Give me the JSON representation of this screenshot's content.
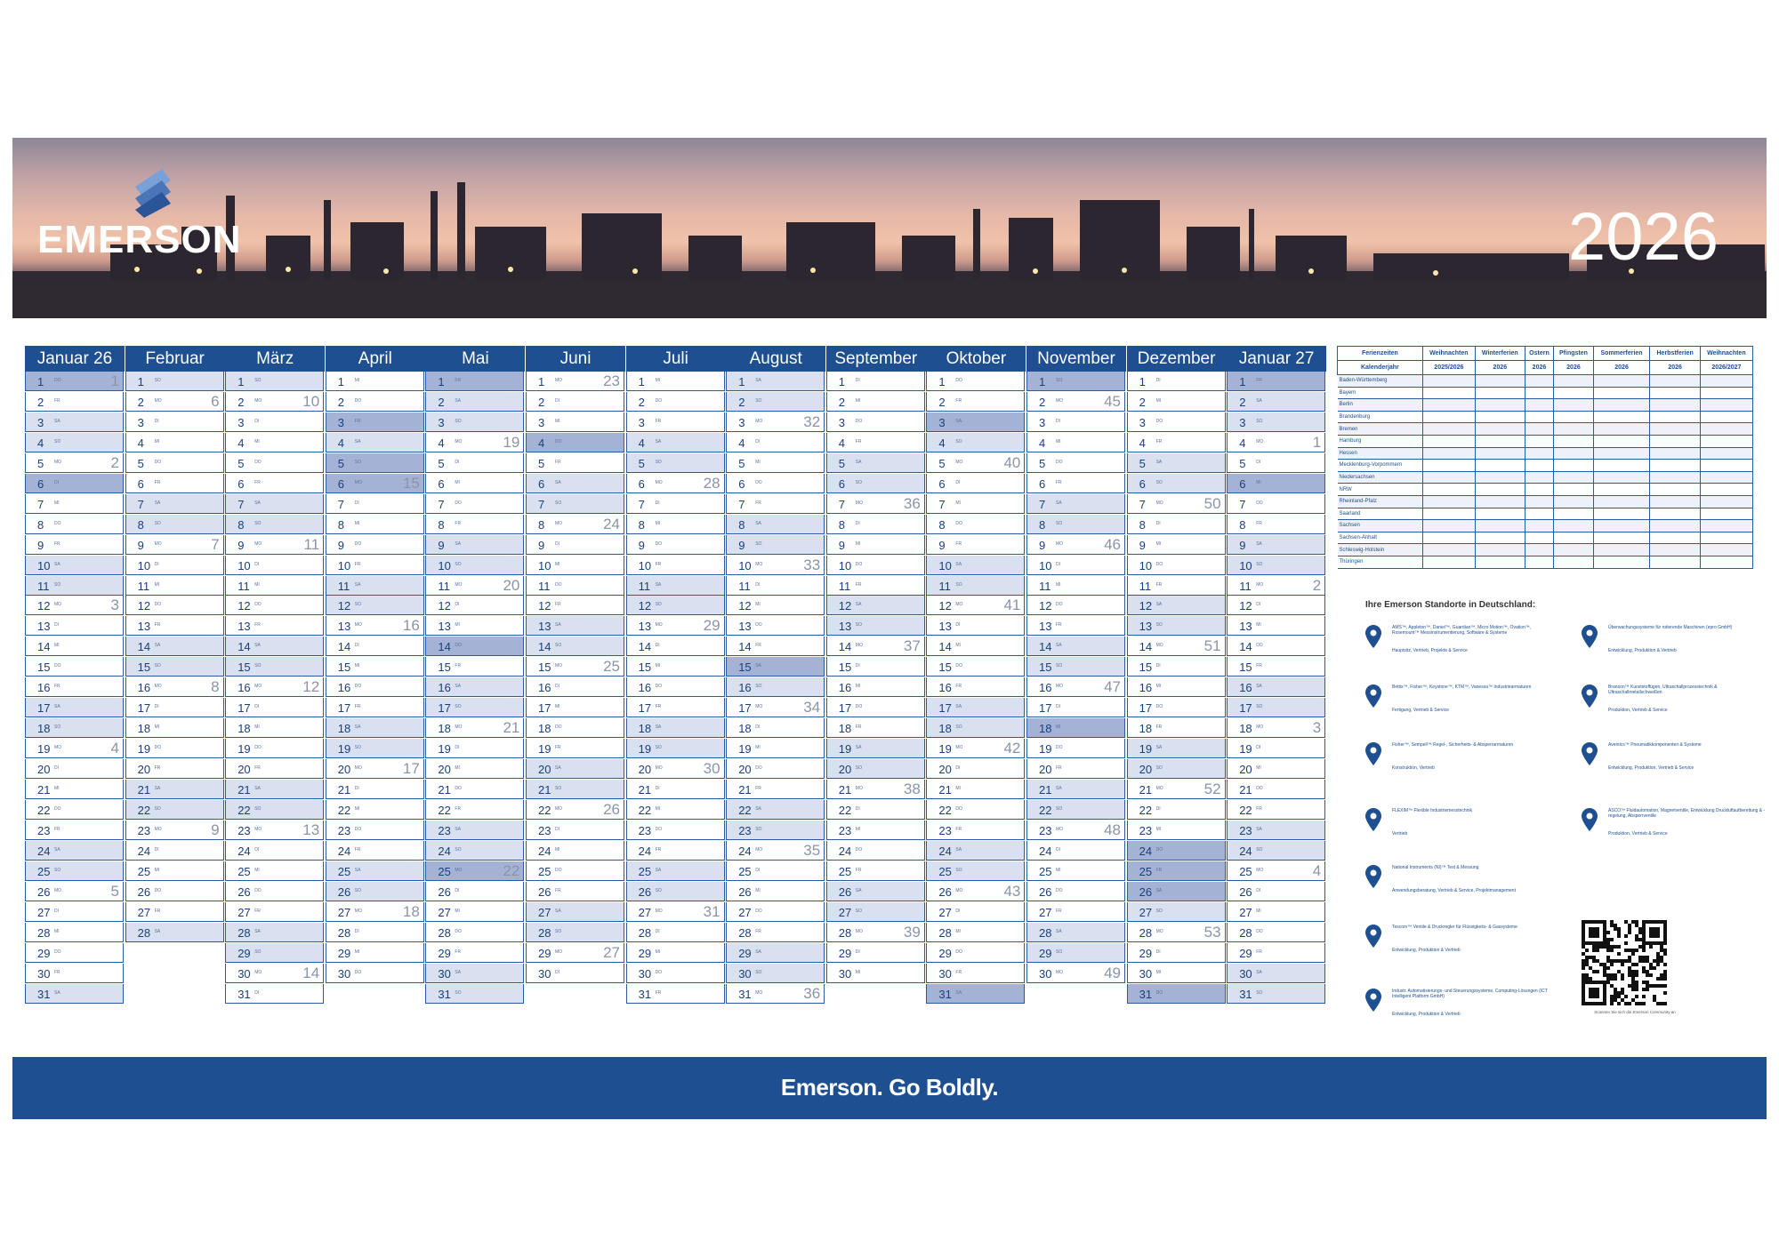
{
  "header": {
    "brand": "EMERSON",
    "year": "2026"
  },
  "calendar": {
    "months": [
      {
        "name": "Januar 26",
        "days": 31,
        "start": 3,
        "kw": {
          "1": "1",
          "5": "2",
          "12": "3",
          "19": "4",
          "26": "5"
        },
        "hol": [
          1,
          6
        ]
      },
      {
        "name": "Februar",
        "days": 28,
        "start": 6,
        "kw": {
          "2": "6",
          "9": "7",
          "16": "8",
          "23": "9"
        },
        "hol": []
      },
      {
        "name": "März",
        "days": 31,
        "start": 6,
        "kw": {
          "2": "10",
          "9": "11",
          "16": "12",
          "23": "13",
          "30": "14"
        },
        "hol": []
      },
      {
        "name": "April",
        "days": 30,
        "start": 2,
        "kw": {
          "6": "15",
          "13": "16",
          "20": "17",
          "27": "18"
        },
        "hol": [
          3,
          5,
          6
        ]
      },
      {
        "name": "Mai",
        "days": 31,
        "start": 4,
        "kw": {
          "4": "19",
          "11": "20",
          "18": "21",
          "25": "22"
        },
        "hol": [
          1,
          14,
          25
        ]
      },
      {
        "name": "Juni",
        "days": 30,
        "start": 0,
        "kw": {
          "1": "23",
          "8": "24",
          "15": "25",
          "22": "26",
          "29": "27"
        },
        "hol": [
          4
        ]
      },
      {
        "name": "Juli",
        "days": 31,
        "start": 2,
        "kw": {
          "6": "28",
          "13": "29",
          "20": "30",
          "27": "31"
        },
        "hol": []
      },
      {
        "name": "August",
        "days": 31,
        "start": 5,
        "kw": {
          "3": "32",
          "10": "33",
          "17": "34",
          "24": "35",
          "31": "36"
        },
        "hol": [
          15
        ]
      },
      {
        "name": "September",
        "days": 30,
        "start": 1,
        "kw": {
          "7": "36",
          "14": "37",
          "21": "38",
          "28": "39"
        },
        "hol": []
      },
      {
        "name": "Oktober",
        "days": 31,
        "start": 3,
        "kw": {
          "5": "40",
          "12": "41",
          "19": "42",
          "26": "43"
        },
        "hol": [
          3,
          31
        ]
      },
      {
        "name": "November",
        "days": 30,
        "start": 6,
        "kw": {
          "2": "45",
          "9": "46",
          "16": "47",
          "23": "48",
          "30": "49"
        },
        "hol": [
          1,
          18
        ]
      },
      {
        "name": "Dezember",
        "days": 31,
        "start": 1,
        "kw": {
          "7": "50",
          "14": "51",
          "21": "52",
          "28": "53"
        },
        "hol": [
          24,
          25,
          26,
          31
        ]
      },
      {
        "name": "Januar 27",
        "days": 31,
        "start": 4,
        "kw": {
          "4": "1",
          "11": "2",
          "18": "3",
          "25": "4"
        },
        "hol": [
          1,
          6
        ]
      }
    ]
  },
  "holidays_table": {
    "headers": [
      "Ferienzeiten",
      "Weihnachten",
      "Winterferien",
      "Ostern",
      "Pfingsten",
      "Sommerferien",
      "Herbstferien",
      "Weihnachten"
    ],
    "subheaders": [
      "Kalenderjahr",
      "2025/2026",
      "2026",
      "2026",
      "2026",
      "2026",
      "2026",
      "2026/2027"
    ],
    "rows": [
      "Baden-Württemberg",
      "Bayern",
      "Berlin",
      "Brandenburg",
      "Bremen",
      "Hamburg",
      "Hessen",
      "Mecklenburg-Vorpommern",
      "Niedersachsen",
      "NRW",
      "Rheinland-Pfalz",
      "Saarland",
      "Sachsen",
      "Sachsen-Anhalt",
      "Schleswig-Holstein",
      "Thüringen"
    ]
  },
  "locations": {
    "title": "Ihre Emerson Standorte in Deutschland:",
    "items": [
      {
        "l1": "AMS™, Appleton™, Daniel™, Guardian™, Micro Motion™, Ovation™, Rosemount™ Messinstrumentierung, Software & Systeme",
        "l2": "Hauptsitz, Vertrieb, Projekte & Service"
      },
      {
        "l1": "Überwachungssysteme für rotierende Maschinen (epro GmbH)",
        "l2": "Entwicklung, Produktion & Vertrieb"
      },
      {
        "l1": "Bettis™, Fisher™, Keystone™, KTM™, Vanessa™ Industriearmaturen",
        "l2": "Fertigung, Vertrieb & Service"
      },
      {
        "l1": "Branson™ Kunststoffügen, Ultraschallprozesstechnik & Ultraschallmetallschweißen",
        "l2": "Produktion, Vertrieb & Service"
      },
      {
        "l1": "Fisher™, Sempell™ Regel-, Sicherheits- & Absperrarmaturen",
        "l2": "Konstruktion, Vertrieb"
      },
      {
        "l1": "Aventics™ Pneumatikkomponenten & Systeme",
        "l2": "Entwicklung, Produktion, Vertrieb & Service"
      },
      {
        "l1": "FLEXIM™ Flexible Industriemesstechnik",
        "l2": "Vertrieb"
      },
      {
        "l1": "ASCO™ Fluidautomation, Magnetventile, Entwicklung Druckluftaufbereitung & -regelung, Absperrventile",
        "l2": "Produktion, Vertrieb & Service"
      },
      {
        "l1": "National Instruments (NI)™ Test & Messung",
        "l2": "Anwendungsberatung, Vertrieb & Service, Projektmanagement"
      },
      {
        "l1": "Tescom™ Ventile & Druckregler für Flüssigkeits- & Gassysteme",
        "l2": "Entwicklung, Produktion & Vertrieb"
      },
      {
        "l1": "Industr. Automatisierungs- und Steuerungssysteme, Computing-Lösungen (ICT Intelligent Platform GmbH)",
        "l2": "Entwicklung, Produktion & Vertrieb"
      }
    ]
  },
  "qr": {
    "caption": "Scannen Sie sich die Emerson Community an"
  },
  "footer": {
    "slogan": "Emerson. Go Boldly."
  },
  "colors": {
    "brand_blue": "#1d4f91",
    "holiday": "#a4b2d6",
    "weekend": "#d9e0ef"
  }
}
